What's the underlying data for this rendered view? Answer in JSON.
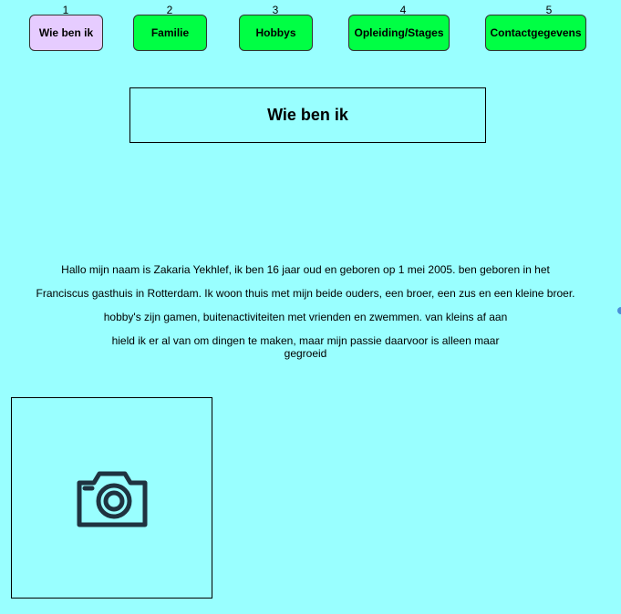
{
  "nav": {
    "items": [
      {
        "number": "1",
        "label": "Wie ben ik"
      },
      {
        "number": "2",
        "label": "Familie"
      },
      {
        "number": "3",
        "label": "Hobbys"
      },
      {
        "number": "4",
        "label": "Opleiding/Stages"
      },
      {
        "number": "5",
        "label": "Contactgegevens"
      }
    ],
    "active_index": 0,
    "colors": {
      "default": "#00ff44",
      "active": "#e6ccff"
    }
  },
  "page": {
    "title": "Wie ben ik",
    "background": "#99ffff",
    "intro_lines": [
      "Hallo mijn naam is Zakaria Yekhlef, ik ben 16 jaar oud en geboren op 1 mei 2005. ben geboren in het",
      "Franciscus gasthuis  in Rotterdam. Ik woon thuis met mijn beide ouders, een broer, een zus en een kleine broer.",
      "hobby's zijn  gamen, buitenactiviteiten met vrienden en zwemmen.  van kleins af aan",
      "hield ik er al van om dingen te maken, maar mijn passie daarvoor is alleen maar",
      "gegroeid"
    ]
  },
  "photo": {
    "icon": "camera-icon"
  }
}
